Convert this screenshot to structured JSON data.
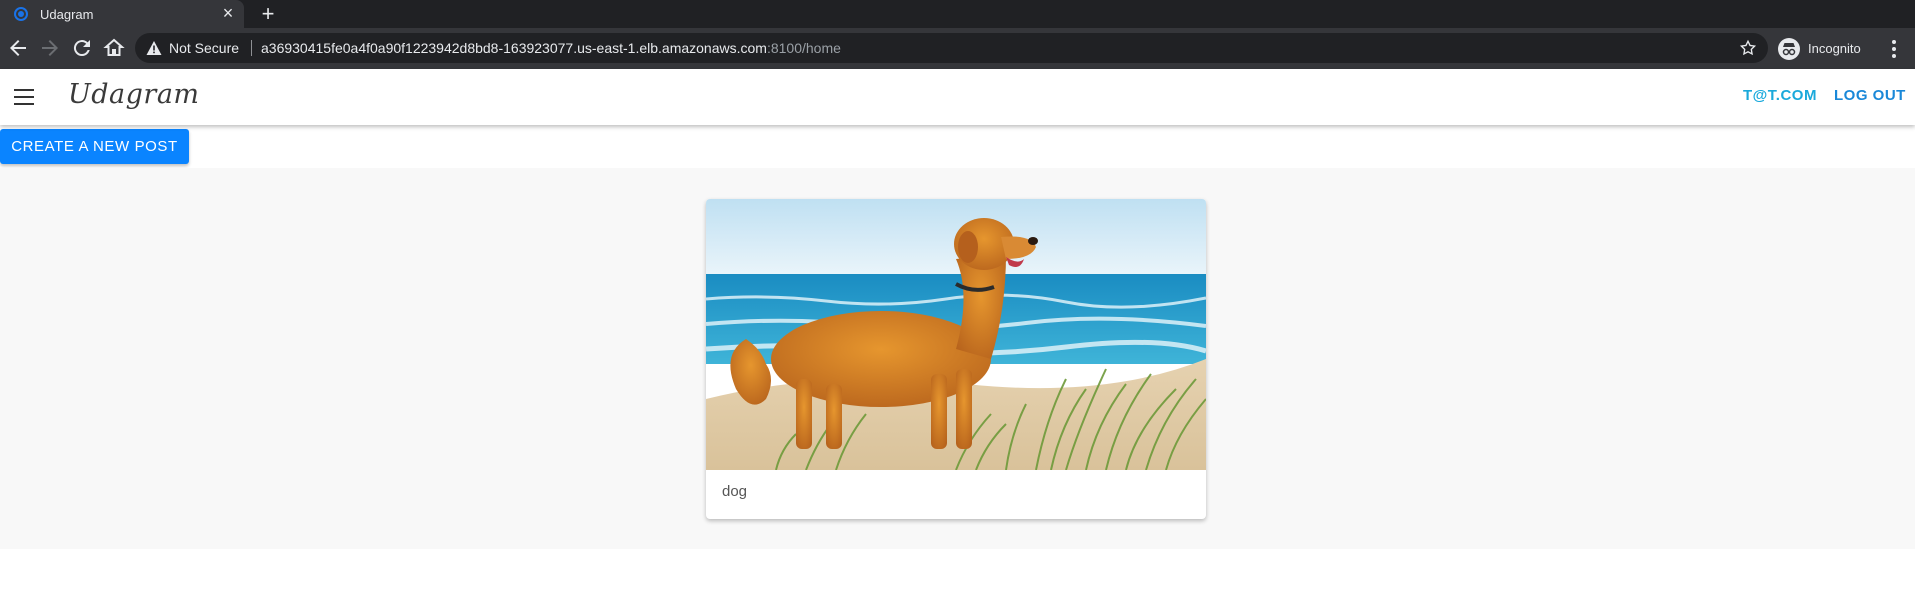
{
  "browser": {
    "tab_title": "Udagram",
    "security_label": "Not Secure",
    "url_host": "a36930415fe0a4f0a90f1223942d8bd8-163923077.us-east-1.elb.amazonaws.com",
    "url_path": ":8100/home",
    "incognito_label": "Incognito",
    "icons": [
      "back-icon",
      "forward-icon",
      "reload-icon",
      "home-icon",
      "warning-icon",
      "star-icon",
      "incognito-icon",
      "more-icon"
    ]
  },
  "app": {
    "brand": "Udagram",
    "user_email": "T@T.COM",
    "logout_label": "LOG OUT",
    "create_post_label": "CREATE A NEW POST",
    "accent_color": "#0a84ff",
    "link_color": "#1a88d8"
  },
  "feed": {
    "items": [
      {
        "caption": "dog",
        "image_subject": "golden retriever on a sandy beach dune"
      }
    ]
  }
}
